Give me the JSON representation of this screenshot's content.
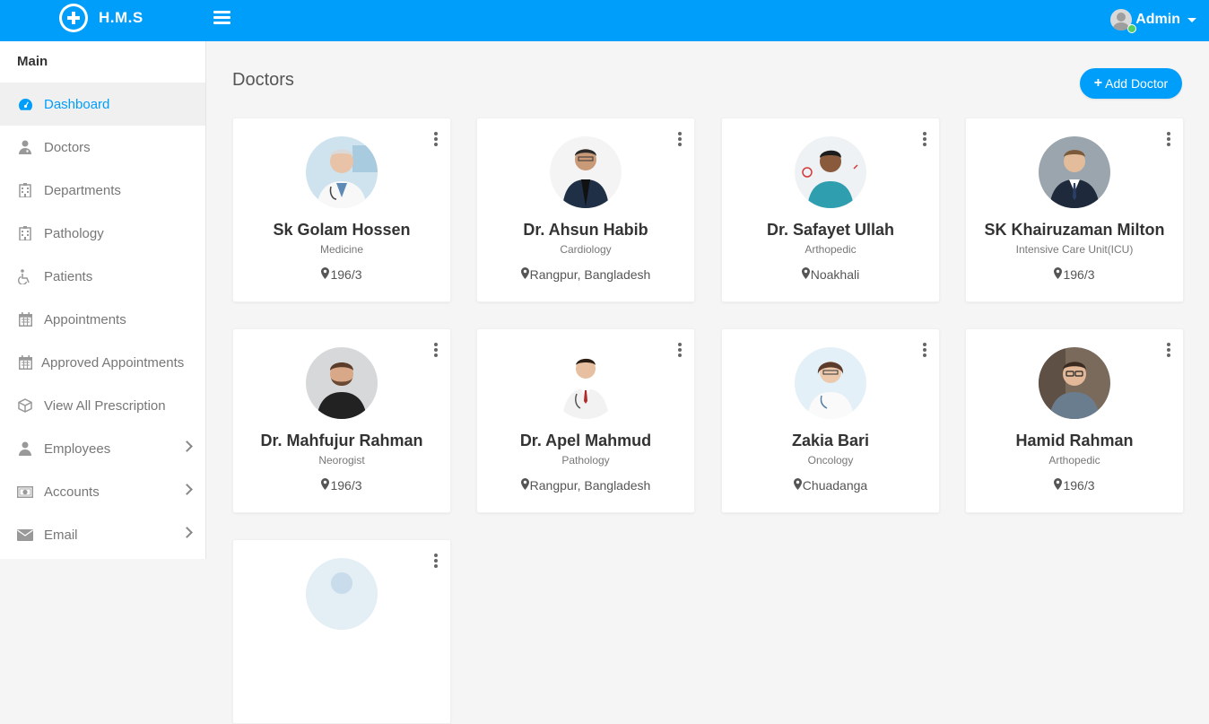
{
  "app": {
    "logo_text": "H.M.S",
    "user_name": "Admin"
  },
  "colors": {
    "primary": "#009efb",
    "online": "#55ce63"
  },
  "sidebar": {
    "section_title": "Main",
    "items": [
      {
        "label": "Dashboard",
        "icon": "dashboard-icon",
        "active": true
      },
      {
        "label": "Doctors",
        "icon": "user-md-icon"
      },
      {
        "label": "Departments",
        "icon": "hospital-icon"
      },
      {
        "label": "Pathology",
        "icon": "hospital-icon"
      },
      {
        "label": "Patients",
        "icon": "wheelchair-icon"
      },
      {
        "label": "Appointments",
        "icon": "calendar-icon"
      },
      {
        "label": "Approved Appointments",
        "icon": "calendar-icon"
      },
      {
        "label": "View All Prescription",
        "icon": "cube-icon"
      },
      {
        "label": "Employees",
        "icon": "user-icon",
        "submenu": true
      },
      {
        "label": "Accounts",
        "icon": "money-icon",
        "submenu": true
      },
      {
        "label": "Email",
        "icon": "envelope-icon",
        "submenu": true
      }
    ]
  },
  "main": {
    "title": "Doctors",
    "add_button_label": "Add Doctor",
    "doctors": [
      {
        "name": "Sk Golam Hossen",
        "department": "Medicine",
        "location": "196/3"
      },
      {
        "name": "Dr. Ahsun Habib",
        "department": "Cardiology",
        "location": "Rangpur, Bangladesh"
      },
      {
        "name": "Dr. Safayet Ullah",
        "department": "Arthopedic",
        "location": "Noakhali"
      },
      {
        "name": "SK Khairuzaman Milton",
        "department": "Intensive Care Unit(ICU)",
        "location": "196/3"
      },
      {
        "name": "Dr. Mahfujur Rahman",
        "department": "Neorogist",
        "location": "196/3"
      },
      {
        "name": "Dr. Apel Mahmud",
        "department": "Pathology",
        "location": "Rangpur, Bangladesh"
      },
      {
        "name": "Zakia Bari",
        "department": "Oncology",
        "location": "Chuadanga"
      },
      {
        "name": "Hamid Rahman",
        "department": "Arthopedic",
        "location": "196/3"
      }
    ]
  }
}
